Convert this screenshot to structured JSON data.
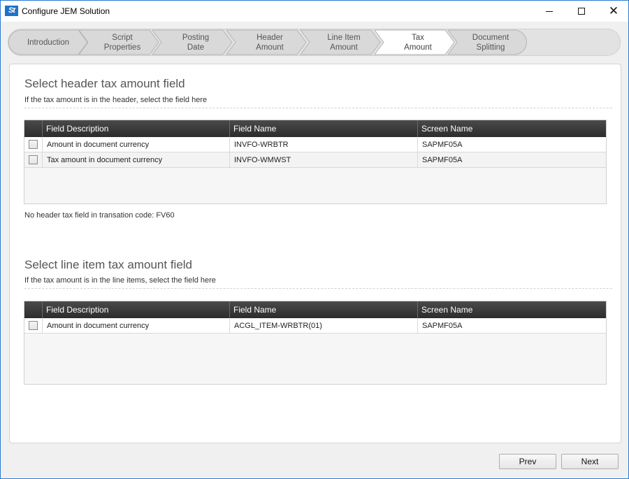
{
  "window": {
    "title": "Configure JEM Solution",
    "logo_text": "St"
  },
  "wizard": {
    "steps": [
      {
        "label": "Introduction",
        "active": false
      },
      {
        "label": "Script\nProperties",
        "active": false
      },
      {
        "label": "Posting\nDate",
        "active": false
      },
      {
        "label": "Header\nAmount",
        "active": false
      },
      {
        "label": "Line Item\nAmount",
        "active": false
      },
      {
        "label": "Tax\nAmount",
        "active": true
      },
      {
        "label": "Document\nSplitting",
        "active": false
      }
    ]
  },
  "header_section": {
    "title": "Select header tax amount field",
    "subtitle": "If the tax amount is in the header, select the field here",
    "columns": [
      "Field Description",
      "Field Name",
      "Screen Name"
    ],
    "rows": [
      {
        "description": "Amount in document currency",
        "field_name": "INVFO-WRBTR",
        "screen_name": "SAPMF05A"
      },
      {
        "description": "Tax amount in document currency",
        "field_name": "INVFO-WMWST",
        "screen_name": "SAPMF05A"
      }
    ],
    "note": "No header tax field in transation code: FV60"
  },
  "line_section": {
    "title": "Select line item tax amount field",
    "subtitle": "If the tax amount is in the line items, select the field here",
    "columns": [
      "Field Description",
      "Field Name",
      "Screen Name"
    ],
    "rows": [
      {
        "description": "Amount in document currency",
        "field_name": "ACGL_ITEM-WRBTR(01)",
        "screen_name": "SAPMF05A"
      }
    ]
  },
  "footer": {
    "prev_label": "Prev",
    "next_label": "Next"
  },
  "colors": {
    "accent": "#1f73c7",
    "grid_header": "#333333",
    "active_step": "#ffffff",
    "inactive_step": "#dcdcdc"
  }
}
